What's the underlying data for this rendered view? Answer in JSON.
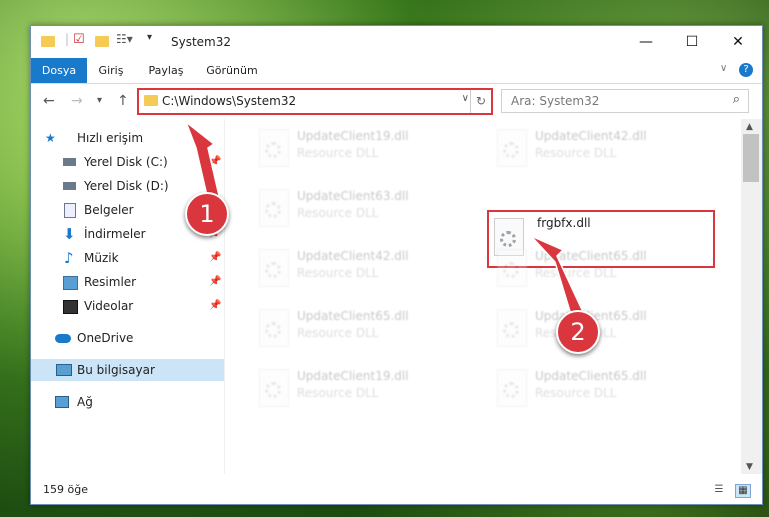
{
  "window": {
    "title": "System32"
  },
  "ribbon": {
    "tabs": [
      {
        "label": "Dosya"
      },
      {
        "label": "Giriş"
      },
      {
        "label": "Paylaş"
      },
      {
        "label": "Görünüm"
      }
    ]
  },
  "address": {
    "path": "C:\\Windows\\System32"
  },
  "search": {
    "placeholder": "Ara: System32"
  },
  "sidebar": {
    "items": [
      {
        "label": "Hızlı erişim",
        "icon": "star-icon"
      },
      {
        "label": "Yerel Disk (C:)",
        "icon": "drive-icon"
      },
      {
        "label": "Yerel Disk (D:)",
        "icon": "drive-icon"
      },
      {
        "label": "Belgeler",
        "icon": "documents-icon"
      },
      {
        "label": "İndirmeler",
        "icon": "download-icon"
      },
      {
        "label": "Müzik",
        "icon": "music-icon"
      },
      {
        "label": "Resimler",
        "icon": "pictures-icon"
      },
      {
        "label": "Videolar",
        "icon": "videos-icon"
      },
      {
        "label": "OneDrive",
        "icon": "cloud-icon"
      },
      {
        "label": "Bu bilgisayar",
        "icon": "computer-icon"
      },
      {
        "label": "Ağ",
        "icon": "network-icon"
      }
    ]
  },
  "files": [
    {
      "name": "UpdateClient19.dll",
      "type": "Resource DLL"
    },
    {
      "name": "UpdateClient42.dll",
      "type": "Resource DLL"
    },
    {
      "name": "UpdateClient63.dll",
      "type": "Resource DLL"
    },
    {
      "name": "frgbfx.dll",
      "type": ""
    },
    {
      "name": "UpdateClient42.dll",
      "type": "Resource DLL"
    },
    {
      "name": "UpdateClient65.dll",
      "type": "Resource DLL"
    },
    {
      "name": "UpdateClient65.dll",
      "type": "Resource DLL"
    },
    {
      "name": "UpdateClient65.dll",
      "type": "Resource DLL"
    },
    {
      "name": "UpdateClient19.dll",
      "type": "Resource DLL"
    },
    {
      "name": "UpdateClient65.dll",
      "type": "Resource DLL"
    }
  ],
  "status": {
    "count": "159 öğe"
  },
  "annotations": {
    "one": "1",
    "two": "2"
  },
  "colors": {
    "accent": "#1979ca",
    "highlight": "#d9363e"
  }
}
